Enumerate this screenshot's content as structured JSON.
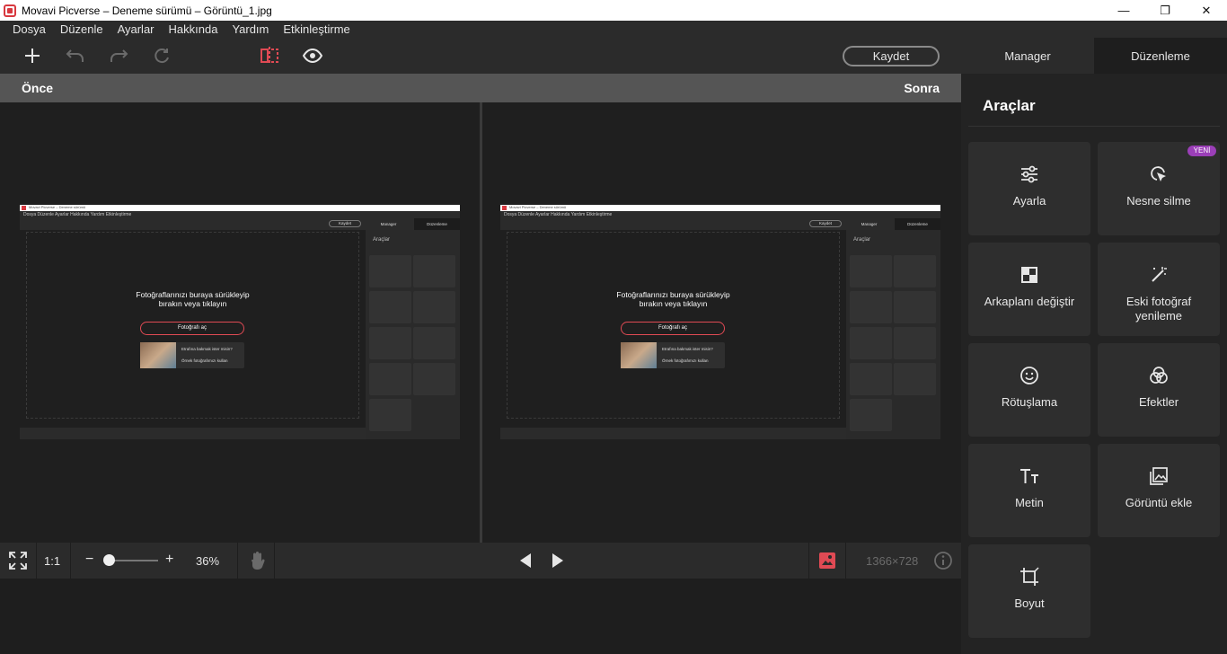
{
  "window": {
    "title": "Movavi Picverse – Deneme sürümü – Görüntü_1.jpg",
    "minimize": "—",
    "maximize": "❐",
    "close": "✕"
  },
  "menu": [
    "Dosya",
    "Düzenle",
    "Ayarlar",
    "Hakkında",
    "Yardım",
    "Etkinleştirme"
  ],
  "toolbar": {
    "save_label": "Kaydet",
    "tabs": [
      "Manager",
      "Düzenleme"
    ],
    "active_tab": "Düzenleme"
  },
  "compare": {
    "before": "Önce",
    "after": "Sonra"
  },
  "thumbnail": {
    "window_title": "Movavi Picverse – Deneme sürümü",
    "menu": "Dosya   Düzenle   Ayarlar   Hakkında   Yardım   Etkinleştirme",
    "save": "Kaydet",
    "tab_manager": "Manager",
    "tab_edit": "Düzenleme",
    "drop_text_1": "Fotoğraflarınızı buraya sürükleyip",
    "drop_text_2": "bırakın veya tıklayın",
    "open_button": "Fotoğrafı aç",
    "sample_q": "Etrafına bakmak ister misin?",
    "sample_use": "Örnek fotoğrafımızı kullan",
    "panel_title": "Araçlar"
  },
  "panel": {
    "title": "Araçlar",
    "badge": "YENİ",
    "tools": [
      {
        "label": "Ayarla",
        "icon": "sliders-icon"
      },
      {
        "label": "Nesne silme",
        "icon": "object-erase-icon"
      },
      {
        "label": "Arkaplanı değiştir",
        "icon": "background-icon"
      },
      {
        "label": "Eski fotoğraf yenileme",
        "icon": "magic-wand-icon"
      },
      {
        "label": "Rötuşlama",
        "icon": "smiley-icon"
      },
      {
        "label": "Efektler",
        "icon": "effects-icon"
      },
      {
        "label": "Metin",
        "icon": "text-icon"
      },
      {
        "label": "Görüntü ekle",
        "icon": "add-image-icon"
      },
      {
        "label": "Boyut",
        "icon": "crop-icon"
      }
    ]
  },
  "bottombar": {
    "ratio": "1:1",
    "zoom_minus": "−",
    "zoom_plus": "+",
    "zoom_percent": "36%",
    "zoom_value": 0.36,
    "dimensions": "1366×728"
  },
  "colors": {
    "accent": "#e04a54",
    "badge": "#9b3fb8",
    "panel_bg": "#232323",
    "card_bg": "#2e2e2e"
  }
}
